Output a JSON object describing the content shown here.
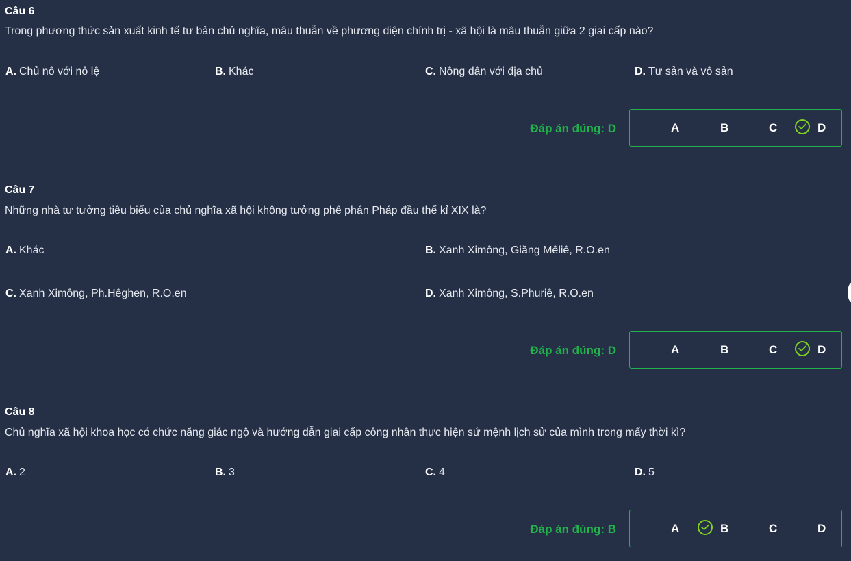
{
  "questions": [
    {
      "title": "Câu 6",
      "text": "Trong phương thức sản xuất kinh tế tư bản chủ nghĩa, mâu thuẫn về phương diện chính trị - xã hội là mâu thuẫn giữa 2 giai cấp nào?",
      "options": [
        {
          "letter": "A.",
          "text": "Chủ nô với nô lệ"
        },
        {
          "letter": "B.",
          "text": "Khác"
        },
        {
          "letter": "C.",
          "text": "Nông dân với địa chủ"
        },
        {
          "letter": "D.",
          "text": "Tư sản và vô sản"
        }
      ],
      "answer_label": "Đáp án đúng: D",
      "choices": [
        "A",
        "B",
        "C",
        "D"
      ],
      "correct": "D"
    },
    {
      "title": "Câu 7",
      "text": "Những nhà tư tưởng tiêu biểu của chủ nghĩa xã hội không tưởng phê phán Pháp đầu thế kỉ XIX là?",
      "options": [
        {
          "letter": "A.",
          "text": "Khác"
        },
        {
          "letter": "B.",
          "text": "Xanh Ximông, Giăng Mêliê, R.O.en"
        },
        {
          "letter": "C.",
          "text": "Xanh Ximông, Ph.Hêghen, R.O.en"
        },
        {
          "letter": "D.",
          "text": "Xanh Ximông, S.Phuriê, R.O.en"
        }
      ],
      "answer_label": "Đáp án đúng: D",
      "choices": [
        "A",
        "B",
        "C",
        "D"
      ],
      "correct": "D"
    },
    {
      "title": "Câu 8",
      "text": "Chủ nghĩa xã hội khoa học có chức năng giác ngộ và hướng dẫn giai cấp công nhân thực hiện sứ mệnh lịch sử của mình trong mấy thời kì?",
      "options": [
        {
          "letter": "A.",
          "text": "2"
        },
        {
          "letter": "B.",
          "text": "3"
        },
        {
          "letter": "C.",
          "text": "4"
        },
        {
          "letter": "D.",
          "text": "5"
        }
      ],
      "answer_label": "Đáp án đúng: B",
      "choices": [
        "A",
        "B",
        "C",
        "D"
      ],
      "correct": "B"
    }
  ],
  "colors": {
    "background": "#252f45",
    "correct_green": "#22b24c",
    "check_green": "#7ed321"
  },
  "icons": {
    "correct_marker": "check-circle-icon"
  }
}
